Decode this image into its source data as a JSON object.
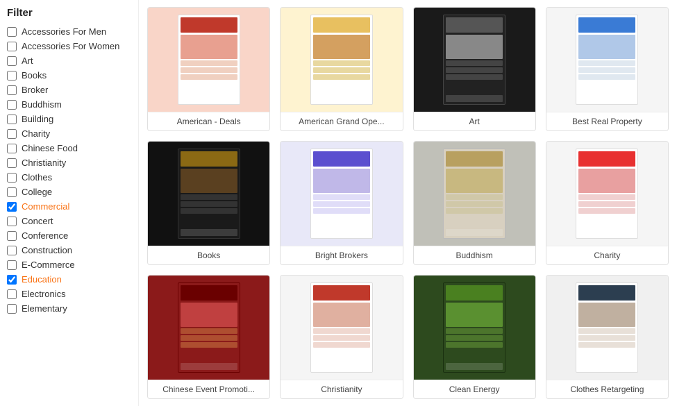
{
  "sidebar": {
    "title": "Filter",
    "items": [
      {
        "id": "accessories-men",
        "label": "Accessories For Men",
        "active": false
      },
      {
        "id": "accessories-women",
        "label": "Accessories For Women",
        "active": false
      },
      {
        "id": "art",
        "label": "Art",
        "active": false
      },
      {
        "id": "books",
        "label": "Books",
        "active": false
      },
      {
        "id": "broker",
        "label": "Broker",
        "active": false
      },
      {
        "id": "buddhism",
        "label": "Buddhism",
        "active": false
      },
      {
        "id": "building",
        "label": "Building",
        "active": false
      },
      {
        "id": "charity",
        "label": "Charity",
        "active": false
      },
      {
        "id": "chinese-food",
        "label": "Chinese Food",
        "active": false
      },
      {
        "id": "christianity",
        "label": "Christianity",
        "active": false
      },
      {
        "id": "clothes",
        "label": "Clothes",
        "active": false
      },
      {
        "id": "college",
        "label": "College",
        "active": false
      },
      {
        "id": "commercial",
        "label": "Commercial",
        "active": true
      },
      {
        "id": "concert",
        "label": "Concert",
        "active": false
      },
      {
        "id": "conference",
        "label": "Conference",
        "active": false
      },
      {
        "id": "construction",
        "label": "Construction",
        "active": false
      },
      {
        "id": "e-commerce",
        "label": "E-Commerce",
        "active": false
      },
      {
        "id": "education",
        "label": "Education",
        "active": true
      },
      {
        "id": "electronics",
        "label": "Electronics",
        "active": false
      },
      {
        "id": "elementary",
        "label": "Elementary",
        "active": false
      }
    ]
  },
  "templates": {
    "grid": [
      {
        "id": "american-deals",
        "name": "American - Deals",
        "thumbClass": "thumb-american-deals"
      },
      {
        "id": "american-grand",
        "name": "American Grand Ope...",
        "thumbClass": "thumb-american-grand"
      },
      {
        "id": "art",
        "name": "Art",
        "thumbClass": "thumb-art"
      },
      {
        "id": "best-real-property",
        "name": "Best Real Property",
        "thumbClass": "thumb-best-real"
      },
      {
        "id": "books",
        "name": "Books",
        "thumbClass": "thumb-books"
      },
      {
        "id": "bright-brokers",
        "name": "Bright Brokers",
        "thumbClass": "thumb-bright-brokers"
      },
      {
        "id": "buddhism",
        "name": "Buddhism",
        "thumbClass": "thumb-buddhism"
      },
      {
        "id": "charity",
        "name": "Charity",
        "thumbClass": "thumb-charity"
      },
      {
        "id": "chinese-event",
        "name": "Chinese Event Promoti...",
        "thumbClass": "thumb-chinese"
      },
      {
        "id": "christianity",
        "name": "Christianity",
        "thumbClass": "thumb-christianity"
      },
      {
        "id": "clean-energy",
        "name": "Clean Energy",
        "thumbClass": "thumb-clean-energy"
      },
      {
        "id": "clothes-retargeting",
        "name": "Clothes Retargeting",
        "thumbClass": "thumb-clothes"
      }
    ]
  }
}
